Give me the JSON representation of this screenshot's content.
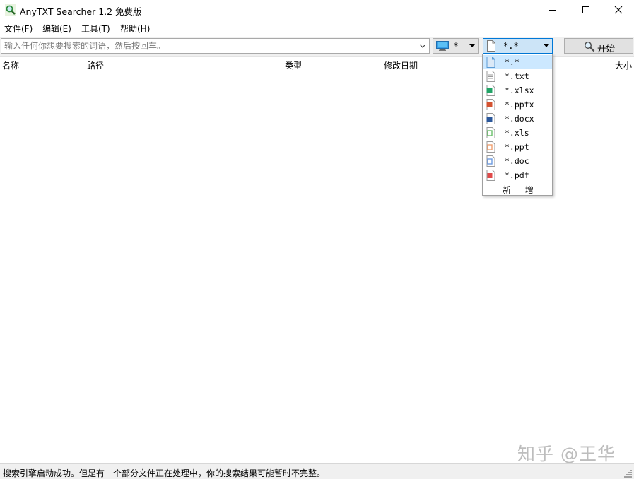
{
  "window": {
    "title": "AnyTXT Searcher 1.2 免费版",
    "icons": {
      "app": "magnifier-icon",
      "minimize": "minimize-icon",
      "maximize": "maximize-icon",
      "close": "close-icon"
    }
  },
  "menu": {
    "file": "文件(F)",
    "edit": "编辑(E)",
    "tools": "工具(T)",
    "help": "帮助(H)"
  },
  "toolbar": {
    "search_value": "",
    "search_placeholder": "输入任何你想要搜索的词语，然后按回车。",
    "drive_value": "*",
    "drive_icon": "monitor-icon",
    "filter_value": "*.*",
    "start_label": "开始",
    "start_icon": "magnifier-icon"
  },
  "columns": {
    "name": "名称",
    "path": "路径",
    "type": "类型",
    "modified": "修改日期",
    "size": "大小"
  },
  "file_types": [
    {
      "label": "*.*",
      "icon": "blank-file-icon",
      "color": "#5b9bd5"
    },
    {
      "label": "*.txt",
      "icon": "text-file-icon",
      "color": "#9a9a9a"
    },
    {
      "label": "*.xlsx",
      "icon": "xlsx-file-icon",
      "color": "#21a366"
    },
    {
      "label": "*.pptx",
      "icon": "pptx-file-icon",
      "color": "#d35230"
    },
    {
      "label": "*.docx",
      "icon": "docx-file-icon",
      "color": "#2b579a"
    },
    {
      "label": "*.xls",
      "icon": "xls-file-icon",
      "color": "#6abf69"
    },
    {
      "label": "*.ppt",
      "icon": "ppt-file-icon",
      "color": "#f0a070"
    },
    {
      "label": "*.doc",
      "icon": "doc-file-icon",
      "color": "#6d9be0"
    },
    {
      "label": "*.pdf",
      "icon": "pdf-file-icon",
      "color": "#e04a4a"
    }
  ],
  "dropdown": {
    "add_label": "新 增"
  },
  "status": {
    "message": "搜索引擎启动成功。但是有一个部分文件正在处理中，你的搜索结果可能暂时不完整。"
  },
  "watermark": "知乎 @王华",
  "colors": {
    "accent": "#0078d7",
    "selected": "#cce8ff"
  }
}
